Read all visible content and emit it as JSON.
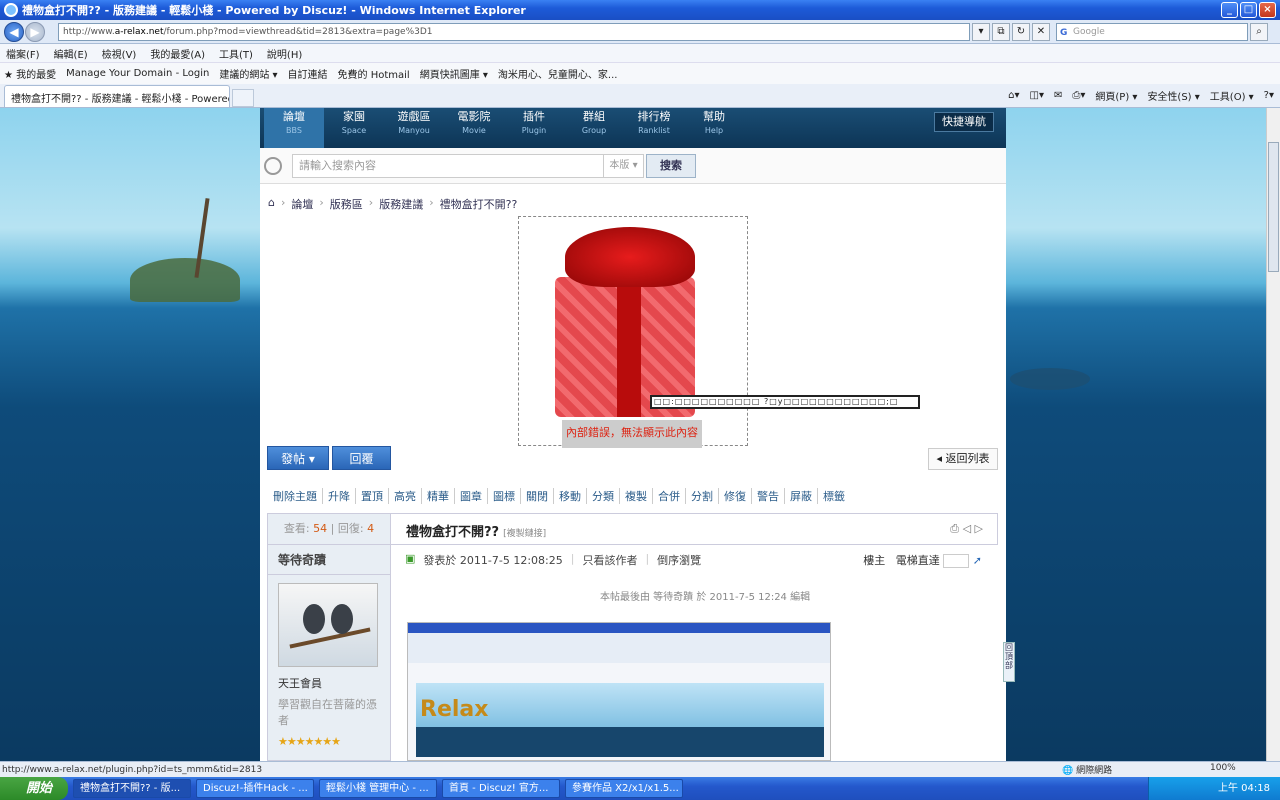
{
  "window": {
    "title": "禮物盒打不開?? - 版務建議 - 輕鬆小棧 - Powered by Discuz! - Windows Internet Explorer"
  },
  "addressbar": {
    "url_prefix": "http://www.",
    "url_domain": "a-relax.net",
    "url_rest": "/forum.php?mod=viewthread&tid=2813&extra=page%3D1",
    "search_placeholder": "Google"
  },
  "menu": [
    "檔案(F)",
    "編輯(E)",
    "檢視(V)",
    "我的最愛(A)",
    "工具(T)",
    "說明(H)"
  ],
  "favorites": [
    "我的最愛",
    "Manage Your Domain - Login",
    "建議的網站 ▾",
    "自訂連結",
    "免費的 Hotmail",
    "網頁快訊圖庫 ▾",
    "淘米用心、兒童開心、家..."
  ],
  "tab": {
    "label": "禮物盒打不開?? - 版務建議 - 輕鬆小棧 - Powered b..."
  },
  "commands": [
    "網頁(P) ▾",
    "安全性(S) ▾",
    "工具(O) ▾"
  ],
  "site": {
    "nav": [
      {
        "label": "論壇",
        "en": "BBS"
      },
      {
        "label": "家園",
        "en": "Space"
      },
      {
        "label": "遊戲區",
        "en": "Manyou"
      },
      {
        "label": "電影院",
        "en": "Movie"
      },
      {
        "label": "插件",
        "en": "Plugin"
      },
      {
        "label": "群組",
        "en": "Group"
      },
      {
        "label": "排行榜",
        "en": "Ranklist"
      },
      {
        "label": "幫助",
        "en": "Help"
      }
    ],
    "quick_nav": "快捷導航",
    "search_placeholder": "請輸入搜索內容",
    "search_scope": "本版 ▾",
    "search_button": "搜索",
    "breadcrumbs": [
      "論壇",
      "版務區",
      "版務建議",
      "禮物盒打不開??"
    ],
    "error_garbled": "□□:□□□□□□□□□□  ?□y□□□□□□□□□□□□;□",
    "error_text": "內部錯誤，無法顯示此內容",
    "post_button": "發帖 ▾",
    "reply_button": "回覆",
    "back_button": "◂ 返回列表",
    "mod_actions": [
      "刪除主題",
      "升降",
      "置頂",
      "高亮",
      "精華",
      "圖章",
      "圖標",
      "關閉",
      "移動",
      "分類",
      "複製",
      "合併",
      "分割",
      "修復",
      "警告",
      "屏蔽",
      "標籤"
    ],
    "views_label": "查看:",
    "views": "54",
    "replies_label": "回復:",
    "replies": "4",
    "thread_title": "禮物盒打不開??",
    "copy_link": "[複製鏈接]",
    "author": "等待奇蹟",
    "rank": "天王會員",
    "motto": "學習觀自在菩薩的憑者",
    "stars": "★★★★★★★",
    "post_date": "發表於 2011-7-5 12:08:25",
    "only_author": "只看該作者",
    "reverse": "倒序瀏覽",
    "floor_label": "樓主",
    "jump_label": "電梯直達",
    "edited_note": "本帖最後由 等待奇蹟 於 2011-7-5 12:24 編輯",
    "side_tab": "回頂部"
  },
  "status": {
    "url": "http://www.a-relax.net/plugin.php?id=ts_mmm&tid=2813",
    "zone": "網際網路",
    "zoom": "100%"
  },
  "taskbar": {
    "start": "開始",
    "tasks": [
      "禮物盒打不開?? - 版...",
      "Discuz!-插件Hack - ...",
      "輕鬆小棧 管理中心 - ...",
      "首頁 - Discuz! 官方...",
      "參賽作品 X2/x1/x1.5..."
    ],
    "clock": "上午 04:18"
  }
}
